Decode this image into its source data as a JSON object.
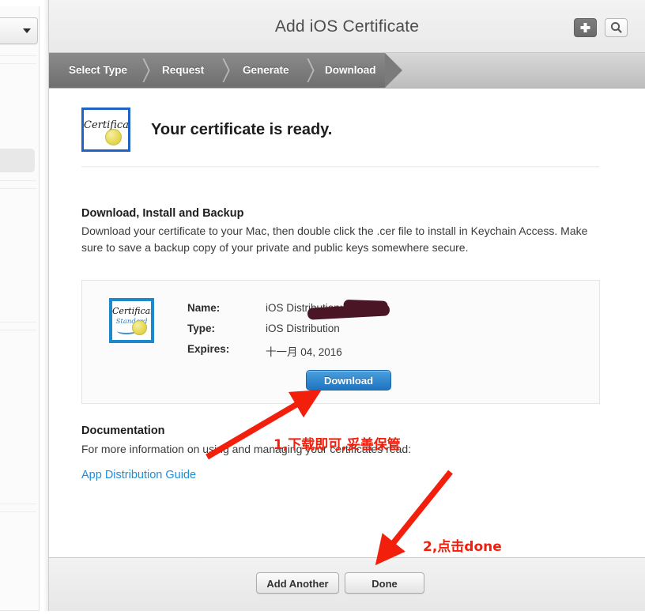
{
  "window": {
    "title": "Add iOS Certificate"
  },
  "titlebar": {
    "add_icon": "plus-icon",
    "search_icon": "search-icon"
  },
  "steps": [
    {
      "label": "Select Type",
      "active": true
    },
    {
      "label": "Request",
      "active": true
    },
    {
      "label": "Generate",
      "active": true
    },
    {
      "label": "Download",
      "active": true
    }
  ],
  "hero": {
    "icon": "certificate-icon",
    "icon_text": "Certificate",
    "headline": "Your certificate is ready."
  },
  "download_section": {
    "title": "Download, Install and Backup",
    "body": "Download your certificate to your Mac, then double click the .cer file to install in Keychain Access. Make sure to save a backup copy of your private and public keys somewhere secure."
  },
  "certificate": {
    "thumb_icon": "certificate-standard-icon",
    "thumb_text_line1": "Certificate",
    "thumb_text_line2": "Standard",
    "fields": [
      {
        "label": "Name:",
        "value": "iOS Distribution:"
      },
      {
        "label": "Type:",
        "value": "iOS Distribution"
      },
      {
        "label": "Expires:",
        "value": "十一月 04, 2016"
      }
    ],
    "download_button": "Download"
  },
  "documentation": {
    "title": "Documentation",
    "body": "For more information on using and managing your certificates read:",
    "link": "App Distribution Guide"
  },
  "footer": {
    "add_another": "Add Another",
    "done": "Done"
  },
  "annotations": [
    {
      "text": "1,下载即可,妥善保管",
      "color": "#f21f0c"
    },
    {
      "text": "2,点击done",
      "color": "#f21f0c"
    }
  ],
  "colors": {
    "accent_blue": "#1f74c0",
    "link_blue": "#1f8dd6",
    "annotation_red": "#f21f0c",
    "step_active": "#7b7b7b"
  }
}
